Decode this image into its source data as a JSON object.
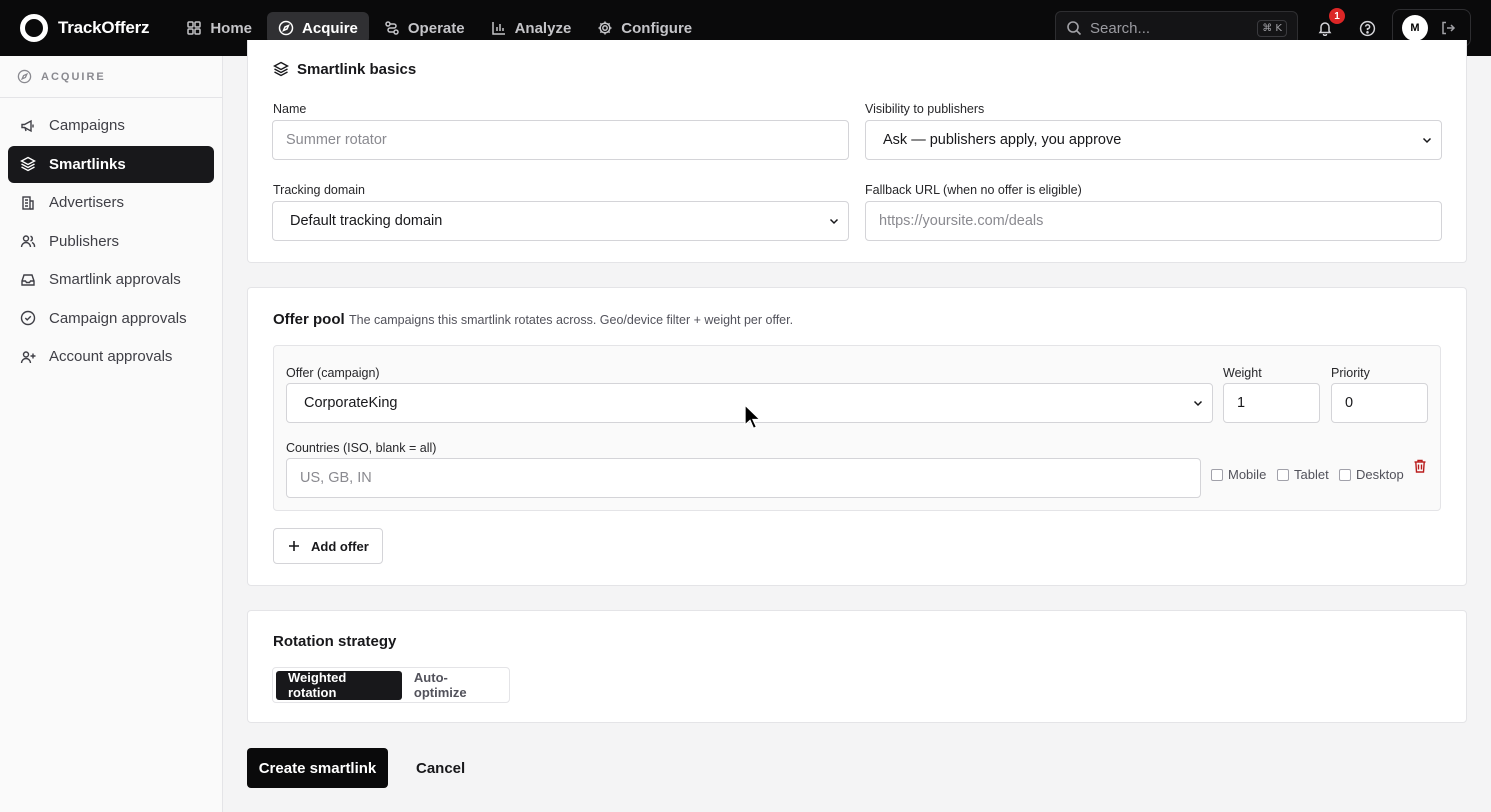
{
  "app": {
    "name": "TrackOfferz"
  },
  "nav": {
    "items": [
      {
        "label": "Home",
        "icon": "grid-icon"
      },
      {
        "label": "Acquire",
        "icon": "compass-icon",
        "active": true
      },
      {
        "label": "Operate",
        "icon": "route-icon"
      },
      {
        "label": "Analyze",
        "icon": "bar-chart-icon"
      },
      {
        "label": "Configure",
        "icon": "gear-icon"
      }
    ]
  },
  "search": {
    "placeholder": "Search...",
    "shortcut": "⌘ K"
  },
  "notifications": {
    "count": "1"
  },
  "user": {
    "initial": "M"
  },
  "sidebar": {
    "section": "ACQUIRE",
    "items": [
      {
        "label": "Campaigns",
        "icon": "megaphone-icon"
      },
      {
        "label": "Smartlinks",
        "icon": "layers-icon",
        "active": true
      },
      {
        "label": "Advertisers",
        "icon": "building-icon"
      },
      {
        "label": "Publishers",
        "icon": "users-icon"
      },
      {
        "label": "Smartlink approvals",
        "icon": "inbox-icon"
      },
      {
        "label": "Campaign approvals",
        "icon": "check-circle-icon"
      },
      {
        "label": "Account approvals",
        "icon": "user-plus-icon"
      }
    ]
  },
  "basics": {
    "title": "Smartlink basics",
    "name_label": "Name",
    "name_placeholder": "Summer rotator",
    "visibility_label": "Visibility to publishers",
    "visibility_value": "Ask — publishers apply, you approve",
    "domain_label": "Tracking domain",
    "domain_value": "Default tracking domain",
    "fallback_label": "Fallback URL (when no offer is eligible)",
    "fallback_placeholder": "https://yoursite.com/deals"
  },
  "offer_pool": {
    "title": "Offer pool",
    "description": "The campaigns this smartlink rotates across. Geo/device filter + weight per offer.",
    "offer_label": "Offer (campaign)",
    "offer_value": "CorporateKing",
    "weight_label": "Weight",
    "weight_value": "1",
    "priority_label": "Priority",
    "priority_value": "0",
    "countries_label": "Countries (ISO, blank = all)",
    "countries_placeholder": "US, GB, IN",
    "devices": [
      "Mobile",
      "Tablet",
      "Desktop"
    ],
    "add_label": "Add offer"
  },
  "rotation": {
    "title": "Rotation strategy",
    "options": [
      "Weighted rotation",
      "Auto-optimize"
    ],
    "selected": "Weighted rotation"
  },
  "actions": {
    "create": "Create smartlink",
    "cancel": "Cancel"
  }
}
